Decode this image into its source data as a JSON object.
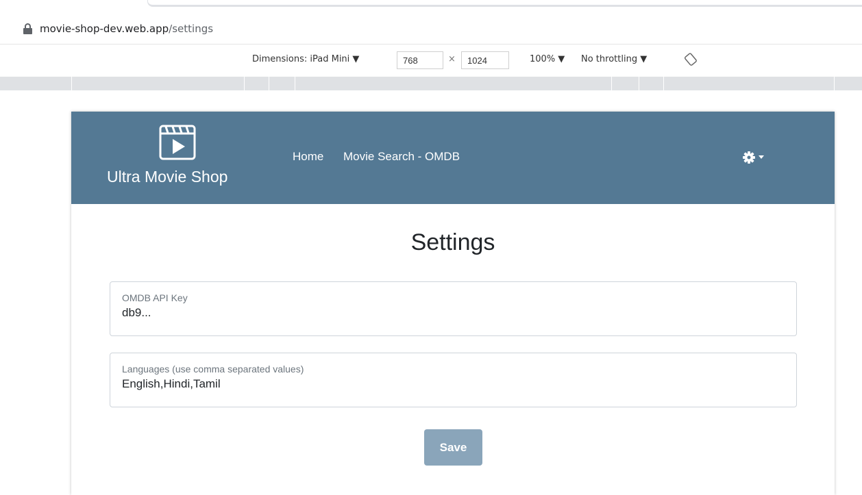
{
  "browser": {
    "url_host": "movie-shop-dev.web.app",
    "url_path": "/settings"
  },
  "devtools": {
    "dimensions_label": "Dimensions: iPad Mini ▼",
    "width_value": "768",
    "times": "×",
    "height_value": "1024",
    "zoom_label": "100% ▼",
    "throttling_label": "No throttling ▼"
  },
  "navbar": {
    "brand_name": "Ultra Movie Shop",
    "links": [
      "Home",
      "Movie Search - OMDB"
    ],
    "background_color": "#547994"
  },
  "settings": {
    "title": "Settings",
    "api_key_label": "OMDB API Key",
    "api_key_value": "db9...",
    "languages_label": "Languages (use comma separated values)",
    "languages_value": "English,Hindi,Tamil",
    "save_label": "Save",
    "save_color": "#8aa5ba"
  },
  "icons": {
    "lock": "lock-icon",
    "rotate": "rotate-icon",
    "film": "film-icon",
    "gear": "gear-icon",
    "caret": "caret-down-icon"
  }
}
